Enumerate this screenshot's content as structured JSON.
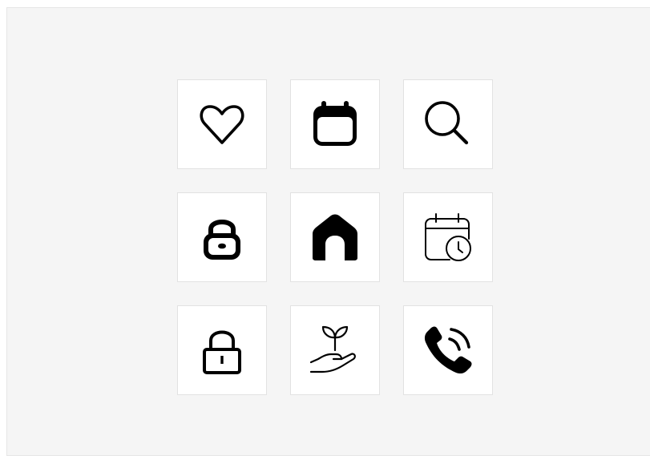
{
  "icons": [
    {
      "name": "heart-outline",
      "row": 0,
      "col": 0
    },
    {
      "name": "calendar-filled",
      "row": 0,
      "col": 1
    },
    {
      "name": "search",
      "row": 0,
      "col": 2
    },
    {
      "name": "lock-bold",
      "row": 1,
      "col": 0
    },
    {
      "name": "home-filled",
      "row": 1,
      "col": 1
    },
    {
      "name": "calendar-clock",
      "row": 1,
      "col": 2
    },
    {
      "name": "lock-outline",
      "row": 2,
      "col": 0
    },
    {
      "name": "hand-sprout",
      "row": 2,
      "col": 1
    },
    {
      "name": "phone-ringing",
      "row": 2,
      "col": 2
    }
  ],
  "colors": {
    "background": "#f5f5f5",
    "tile": "#ffffff",
    "tile_border": "#e2e2e2",
    "icon": "#000000"
  }
}
